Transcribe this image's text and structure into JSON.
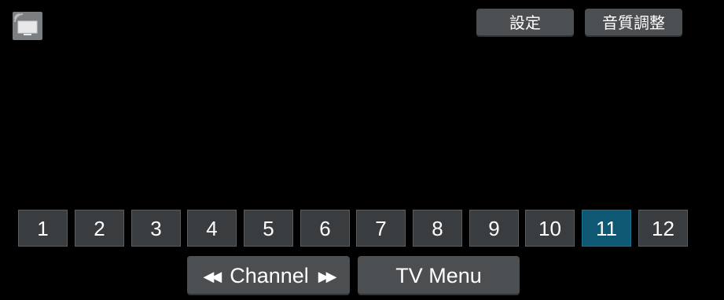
{
  "header": {
    "tv_icon": "tv-cast-icon",
    "settings_label": "設定",
    "sound_label": "音質調整"
  },
  "channels": {
    "buttons": [
      "1",
      "2",
      "3",
      "4",
      "5",
      "6",
      "7",
      "8",
      "9",
      "10",
      "11",
      "12"
    ],
    "selected": "11"
  },
  "footer": {
    "prev_icon": "skip-previous-icon",
    "channel_label": "Channel",
    "next_icon": "skip-next-icon",
    "tv_menu_label": "TV Menu"
  },
  "colors": {
    "background": "#000000",
    "button": "#4b4f52",
    "channel_button": "#3a3d40",
    "selected_channel": "#0e5873"
  }
}
